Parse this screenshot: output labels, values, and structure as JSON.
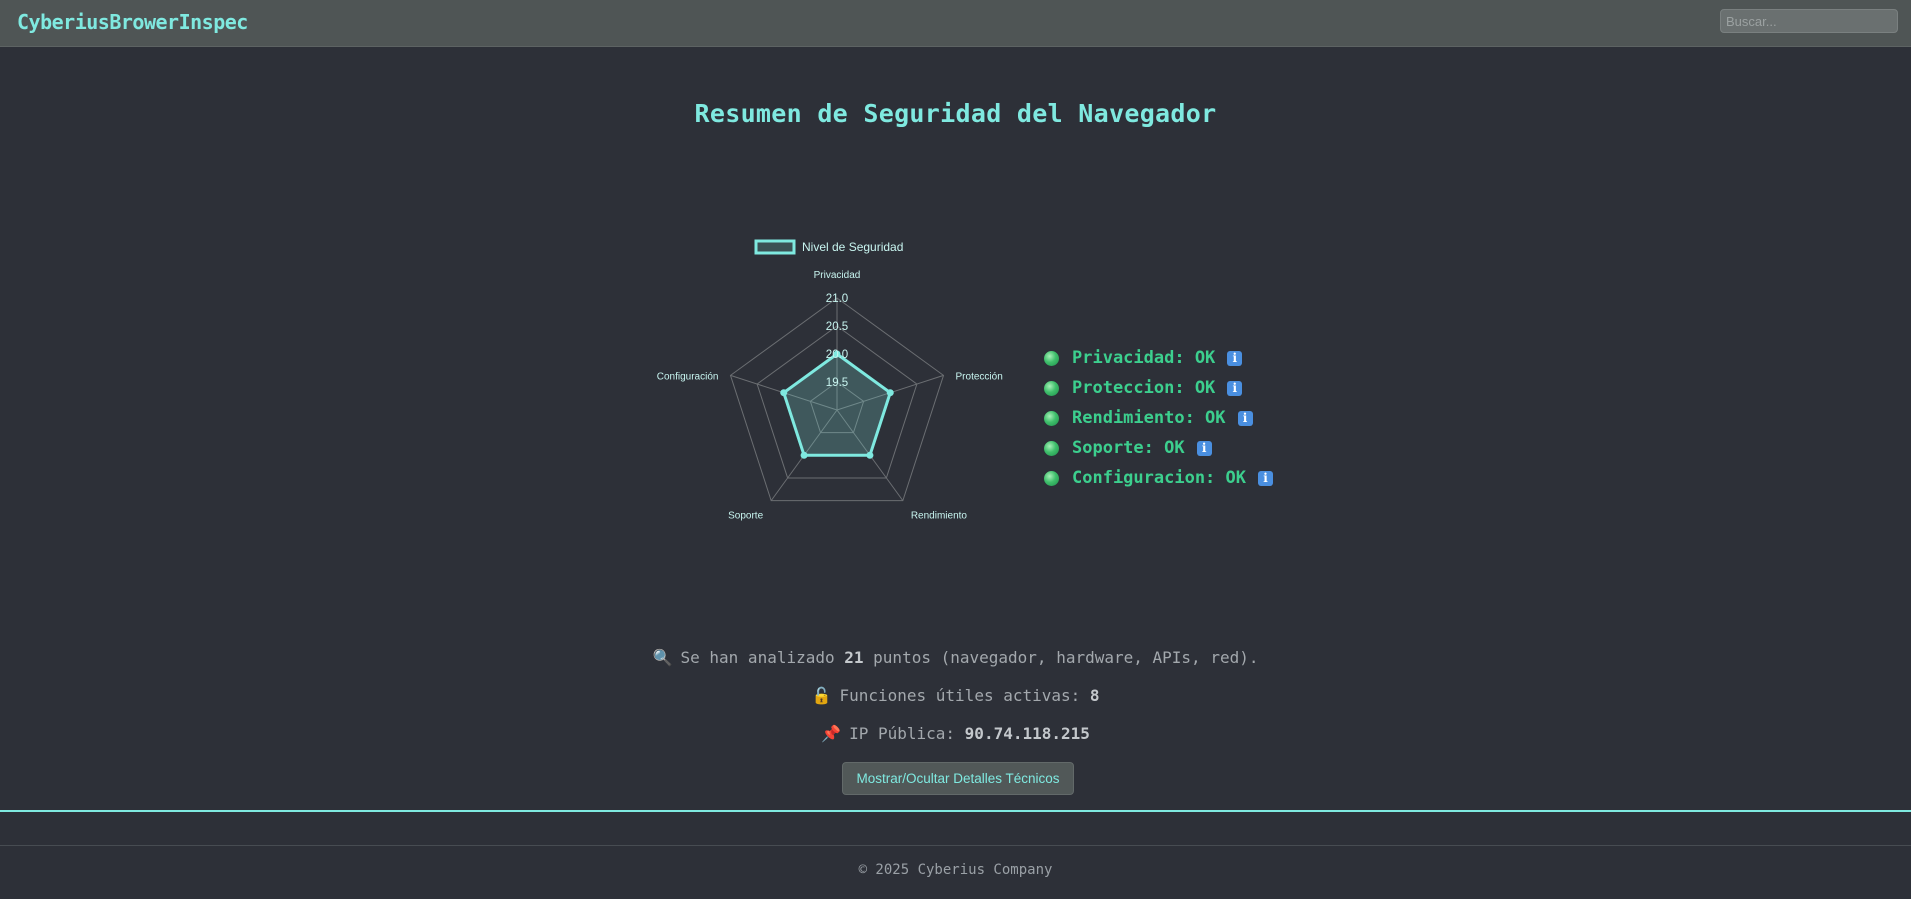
{
  "header": {
    "brand": "CyberiusBrowerInspec",
    "search_placeholder": "Buscar..."
  },
  "main": {
    "title": "Resumen de Seguridad del Navegador"
  },
  "chart_data": {
    "type": "radar",
    "legend": "Nivel de Seguridad",
    "categories": [
      "Privacidad",
      "Protección",
      "Rendimiento",
      "Soporte",
      "Configuración"
    ],
    "series": [
      {
        "name": "Nivel de Seguridad",
        "values": [
          20.0,
          20.0,
          20.0,
          20.0,
          20.0
        ]
      }
    ],
    "range": [
      19.0,
      21.0
    ],
    "ticks": [
      "19.5",
      "20.0",
      "20.5",
      "21.0"
    ],
    "tick_values": [
      19.5,
      20.0,
      20.5,
      21.0
    ],
    "colors": {
      "series": "#7fe9e0",
      "grid": "#6b6e72",
      "labels": "#c8f5f0"
    }
  },
  "status": {
    "items": [
      {
        "label": "Privacidad: OK",
        "icon": "info-icon"
      },
      {
        "label": "Proteccion: OK",
        "icon": "info-icon"
      },
      {
        "label": "Rendimiento: OK",
        "icon": "info-icon"
      },
      {
        "label": "Soporte: OK",
        "icon": "info-icon"
      },
      {
        "label": "Configuracion: OK",
        "icon": "info-icon"
      }
    ],
    "ok_color": "#3ccf8e"
  },
  "summary": {
    "analyzed_prefix": "Se han analizado ",
    "analyzed_count": "21",
    "analyzed_suffix": " puntos (navegador, hardware, APIs, red).",
    "functions_label": "Funciones útiles activas: ",
    "functions_count": "8",
    "ip_label": "IP Pública: ",
    "ip_value": "90.74.118.215",
    "icons": [
      "magnifier-icon",
      "unlocked-padlock-icon",
      "pushpin-icon"
    ]
  },
  "actions": {
    "toggle_details": "Mostrar/Ocultar Detalles Técnicos"
  },
  "footer": {
    "copyright": "© 2025 Cyberius Company"
  }
}
